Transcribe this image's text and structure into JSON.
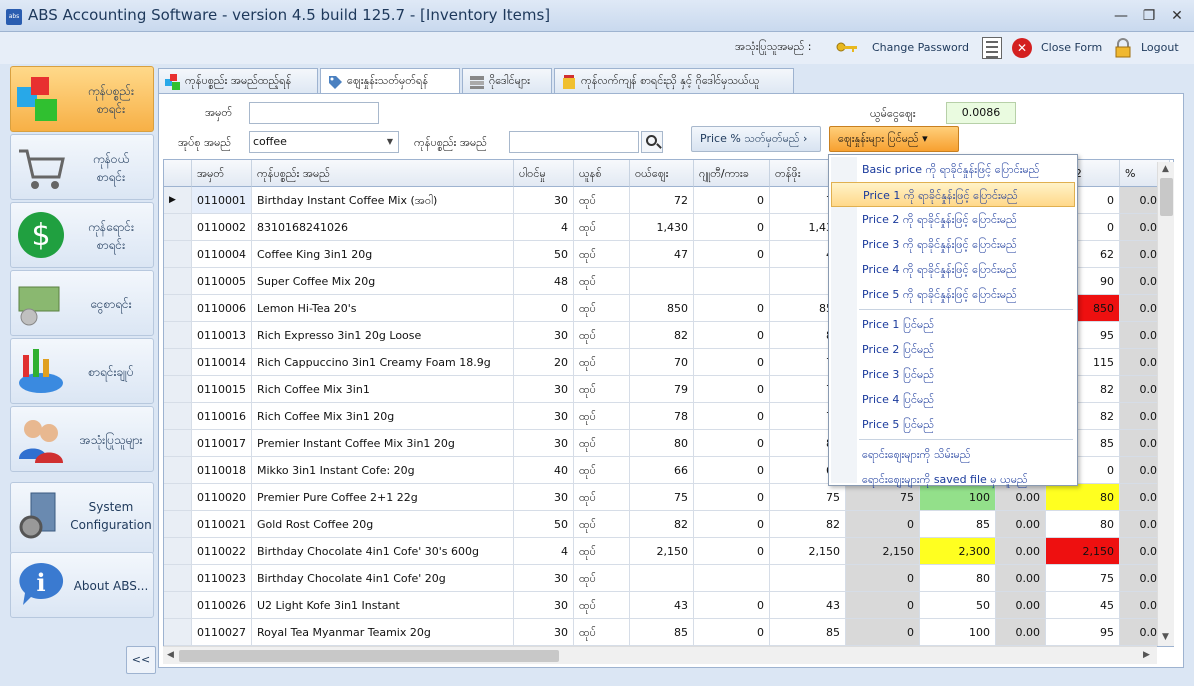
{
  "window": {
    "title": "ABS Accounting Software - version 4.5 build 125.7 - [Inventory Items]",
    "minimize": "—",
    "restore": "❐",
    "close": "✕",
    "app_icon_text": "abs"
  },
  "topbar": {
    "user_label": "အသုံးပြုသူအမည် :",
    "change_password": "Change Password",
    "close_form": "Close Form",
    "logout": "Logout"
  },
  "sidebar": {
    "items": [
      {
        "label": "ကုန်ပစ္စည်း\nစာရင်း",
        "icon": "boxes-icon"
      },
      {
        "label": "ကုန်ဝယ်\nစာရင်း",
        "icon": "cart-icon"
      },
      {
        "label": "ကုန်ရောင်း\nစာရင်း",
        "icon": "dollar-icon"
      },
      {
        "label": "ငွေစာရင်း",
        "icon": "money-icon"
      },
      {
        "label": "စာရင်းချုပ်",
        "icon": "chart-icon"
      },
      {
        "label": "အသုံးပြုသူများ",
        "icon": "users-icon"
      },
      {
        "label": "System\nConfiguration",
        "icon": "config-icon"
      },
      {
        "label": "About ABS...",
        "icon": "info-icon"
      }
    ],
    "collapse": "<<"
  },
  "tabs": [
    {
      "label": "ကုန်ပစ္စည်း အမည်ထည့်ရန်"
    },
    {
      "label": "ဈေးနှုန်းသတ်မှတ်ရန်"
    },
    {
      "label": "ဂိုဒေါင်များ"
    },
    {
      "label": "ကုန်လက်ကျန် စာရင်းညှိ နှင့် ဂိုဒေါင်မှသယ်ယူ"
    }
  ],
  "form": {
    "code_label": "အမှတ်",
    "code_value": "",
    "category_label": "အုပ်စု အမည်",
    "category_value": "coffee",
    "item_name_label": "ကုန်ပစ္စည်း အမည်",
    "item_name_value": "",
    "rate_label": "ယွမ်ငွေဈေး",
    "rate_value": "0.0086",
    "price_pct_button": "Price % သတ်မှတ်မည်",
    "show_prices_button": "ဈေးနှုန်းများ ပြင်မည်"
  },
  "table": {
    "headers": [
      "အမှတ်",
      "ကုန်ပစ္စည်း အမည်",
      "ပါဝင်မှု",
      "ယူနစ်",
      "ဝယ်ဈေး",
      "ဂျူတီ/ကားခ",
      "တန်ဖိုး",
      "",
      "",
      "",
      "rice 2",
      "%"
    ],
    "rows": [
      [
        "0110001",
        "Birthday Instant Coffee Mix (အဝါ)",
        "30",
        "ထုပ်",
        "72",
        "0",
        "72",
        "",
        "",
        "",
        "0",
        "0.00"
      ],
      [
        "0110002",
        "8310168241026",
        "4",
        "ထုပ်",
        "1,430",
        "0",
        "1,430",
        "",
        "",
        "",
        "0",
        "0.00"
      ],
      [
        "0110004",
        "Coffee King 3in1 20g",
        "50",
        "ထုပ်",
        "47",
        "0",
        "47",
        "",
        "",
        "",
        "62",
        "0.00"
      ],
      [
        "0110005",
        "Super Coffee Mix 20g",
        "48",
        "ထုပ်",
        "",
        "",
        "",
        "",
        "",
        "",
        "90",
        "0.00"
      ],
      [
        "0110006",
        "Lemon Hi-Tea 20's",
        "0",
        "ထုပ်",
        "850",
        "0",
        "850",
        "",
        "",
        "",
        "850",
        "0.00"
      ],
      [
        "0110013",
        "Rich Expresso 3in1 20g Loose",
        "30",
        "ထုပ်",
        "82",
        "0",
        "82",
        "",
        "",
        "",
        "95",
        "0.00"
      ],
      [
        "0110014",
        "Rich Cappuccino 3in1 Creamy Foam 18.9g",
        "20",
        "ထုပ်",
        "70",
        "0",
        "70",
        "",
        "",
        "",
        "115",
        "0.00"
      ],
      [
        "0110015",
        "Rich Coffee Mix 3in1",
        "30",
        "ထုပ်",
        "79",
        "0",
        "79",
        "",
        "",
        "",
        "82",
        "0.00"
      ],
      [
        "0110016",
        "Rich Coffee Mix 3in1 20g",
        "30",
        "ထုပ်",
        "78",
        "0",
        "78",
        "",
        "",
        "",
        "82",
        "0.00"
      ],
      [
        "0110017",
        "Premier Instant Coffee Mix 3in1 20g",
        "30",
        "ထုပ်",
        "80",
        "0",
        "80",
        "",
        "",
        "",
        "85",
        "0.00"
      ],
      [
        "0110018",
        "Mikko 3in1 Instant Cofe: 20g",
        "40",
        "ထုပ်",
        "66",
        "0",
        "66",
        "",
        "",
        "",
        "0",
        "0.00"
      ],
      [
        "0110020",
        "Premier Pure Coffee 2+1 22g",
        "30",
        "ထုပ်",
        "75",
        "0",
        "75",
        "75",
        "100",
        "0.00",
        "80",
        "0.00"
      ],
      [
        "0110021",
        "Gold Rost Coffee 20g",
        "50",
        "ထုပ်",
        "82",
        "0",
        "82",
        "0",
        "85",
        "0.00",
        "80",
        "0.00"
      ],
      [
        "0110022",
        "Birthday Chocolate 4in1 Cofe' 30's 600g",
        "4",
        "ထုပ်",
        "2,150",
        "0",
        "2,150",
        "2,150",
        "2,300",
        "0.00",
        "2,150",
        "0.00"
      ],
      [
        "0110023",
        "Birthday Chocolate 4in1 Cofe' 20g",
        "30",
        "ထုပ်",
        "",
        "",
        "",
        "0",
        "80",
        "0.00",
        "75",
        "0.00"
      ],
      [
        "0110026",
        "U2 Light Kofe 3in1 Instant",
        "30",
        "ထုပ်",
        "43",
        "0",
        "43",
        "0",
        "50",
        "0.00",
        "45",
        "0.00"
      ],
      [
        "0110027",
        "Royal Tea Myanmar Teamix 20g",
        "30",
        "ထုပ်",
        "85",
        "0",
        "85",
        "0",
        "100",
        "0.00",
        "95",
        "0.00"
      ]
    ],
    "row_marker": "▶"
  },
  "colors": {
    "green": "#93e08a",
    "yellow": "#ffff20",
    "red": "#ee1010",
    "accent_orange": "#f7a030"
  },
  "menu": {
    "items": [
      "Basic price ကို ရာခိုင်နှုန်းဖြင့် ပြောင်းမည်",
      "Price 1 ကို ရာခိုင်နှုန်းဖြင့် ပြောင်းမည်",
      "Price 2 ကို ရာခိုင်နှုန်းဖြင့် ပြောင်းမည်",
      "Price 3 ကို ရာခိုင်နှုန်းဖြင့် ပြောင်းမည်",
      "Price 4 ကို ရာခိုင်နှုန်းဖြင့် ပြောင်းမည်",
      "Price 5 ကို ရာခိုင်နှုန်းဖြင့် ပြောင်းမည်",
      "Price 1 ပြင်မည်",
      "Price 2 ပြင်မည်",
      "Price 3 ပြင်မည်",
      "Price 4 ပြင်မည်",
      "Price 5 ပြင်မည်",
      "ရောင်းဈေးများကို သိမ်းမည်",
      "ရောင်းဈေးများကို saved file မှ ယူမည်"
    ]
  }
}
